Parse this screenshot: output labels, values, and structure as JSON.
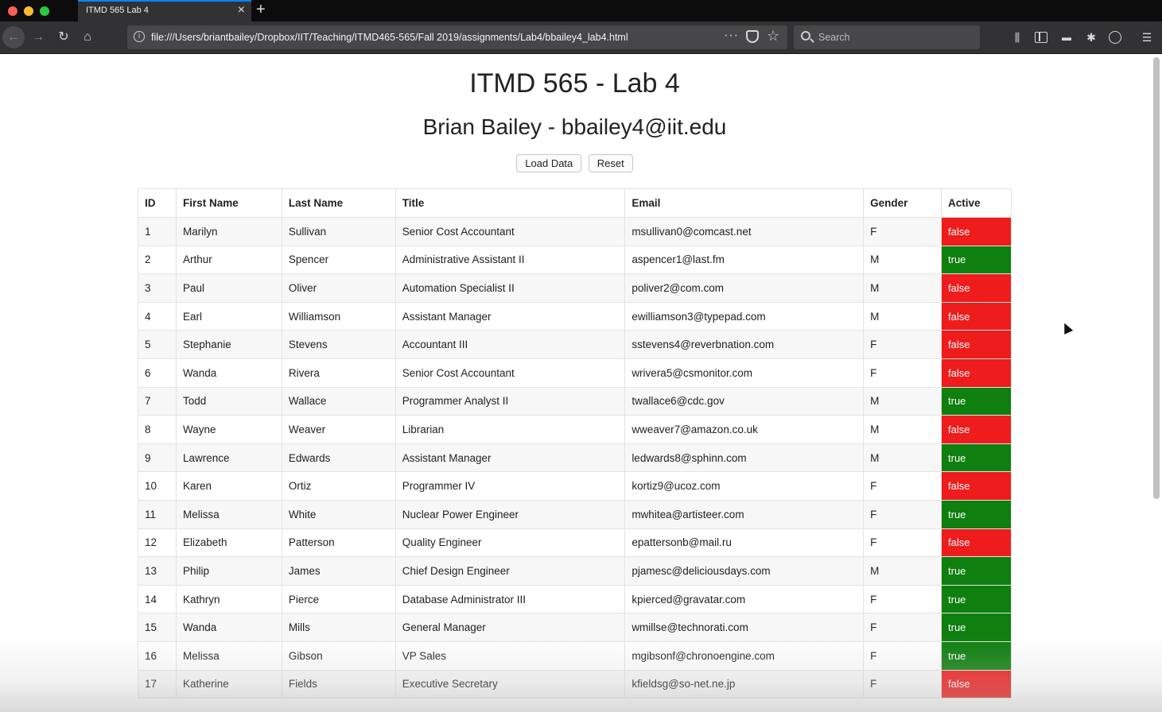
{
  "browser": {
    "tab_title": "ITMD 565 Lab 4",
    "url": "file:///Users/briantbailey/Dropbox/IIT/Teaching/ITMD465-565/Fall 2019/assignments/Lab4/bbailey4_lab4.html",
    "search_placeholder": "Search"
  },
  "page": {
    "title": "ITMD 565 - Lab 4",
    "subtitle": "Brian Bailey - bbailey4@iit.edu",
    "load_button": "Load Data",
    "reset_button": "Reset"
  },
  "table": {
    "headers": [
      "ID",
      "First Name",
      "Last Name",
      "Title",
      "Email",
      "Gender",
      "Active"
    ],
    "rows": [
      [
        "1",
        "Marilyn",
        "Sullivan",
        "Senior Cost Accountant",
        "msullivan0@comcast.net",
        "F",
        "false"
      ],
      [
        "2",
        "Arthur",
        "Spencer",
        "Administrative Assistant II",
        "aspencer1@last.fm",
        "M",
        "true"
      ],
      [
        "3",
        "Paul",
        "Oliver",
        "Automation Specialist II",
        "poliver2@com.com",
        "M",
        "false"
      ],
      [
        "4",
        "Earl",
        "Williamson",
        "Assistant Manager",
        "ewilliamson3@typepad.com",
        "M",
        "false"
      ],
      [
        "5",
        "Stephanie",
        "Stevens",
        "Accountant III",
        "sstevens4@reverbnation.com",
        "F",
        "false"
      ],
      [
        "6",
        "Wanda",
        "Rivera",
        "Senior Cost Accountant",
        "wrivera5@csmonitor.com",
        "F",
        "false"
      ],
      [
        "7",
        "Todd",
        "Wallace",
        "Programmer Analyst II",
        "twallace6@cdc.gov",
        "M",
        "true"
      ],
      [
        "8",
        "Wayne",
        "Weaver",
        "Librarian",
        "wweaver7@amazon.co.uk",
        "M",
        "false"
      ],
      [
        "9",
        "Lawrence",
        "Edwards",
        "Assistant Manager",
        "ledwards8@sphinn.com",
        "M",
        "true"
      ],
      [
        "10",
        "Karen",
        "Ortiz",
        "Programmer IV",
        "kortiz9@ucoz.com",
        "F",
        "false"
      ],
      [
        "11",
        "Melissa",
        "White",
        "Nuclear Power Engineer",
        "mwhitea@artisteer.com",
        "F",
        "true"
      ],
      [
        "12",
        "Elizabeth",
        "Patterson",
        "Quality Engineer",
        "epattersonb@mail.ru",
        "F",
        "false"
      ],
      [
        "13",
        "Philip",
        "James",
        "Chief Design Engineer",
        "pjamesc@deliciousdays.com",
        "M",
        "true"
      ],
      [
        "14",
        "Kathryn",
        "Pierce",
        "Database Administrator III",
        "kpierced@gravatar.com",
        "F",
        "true"
      ],
      [
        "15",
        "Wanda",
        "Mills",
        "General Manager",
        "wmillse@technorati.com",
        "F",
        "true"
      ],
      [
        "16",
        "Melissa",
        "Gibson",
        "VP Sales",
        "mgibsonf@chronoengine.com",
        "F",
        "true"
      ],
      [
        "17",
        "Katherine",
        "Fields",
        "Executive Secretary",
        "kfieldsg@so-net.ne.jp",
        "F",
        "false"
      ]
    ]
  },
  "colors": {
    "active_true": "#0f7f0f",
    "active_false": "#ee1c1c"
  }
}
